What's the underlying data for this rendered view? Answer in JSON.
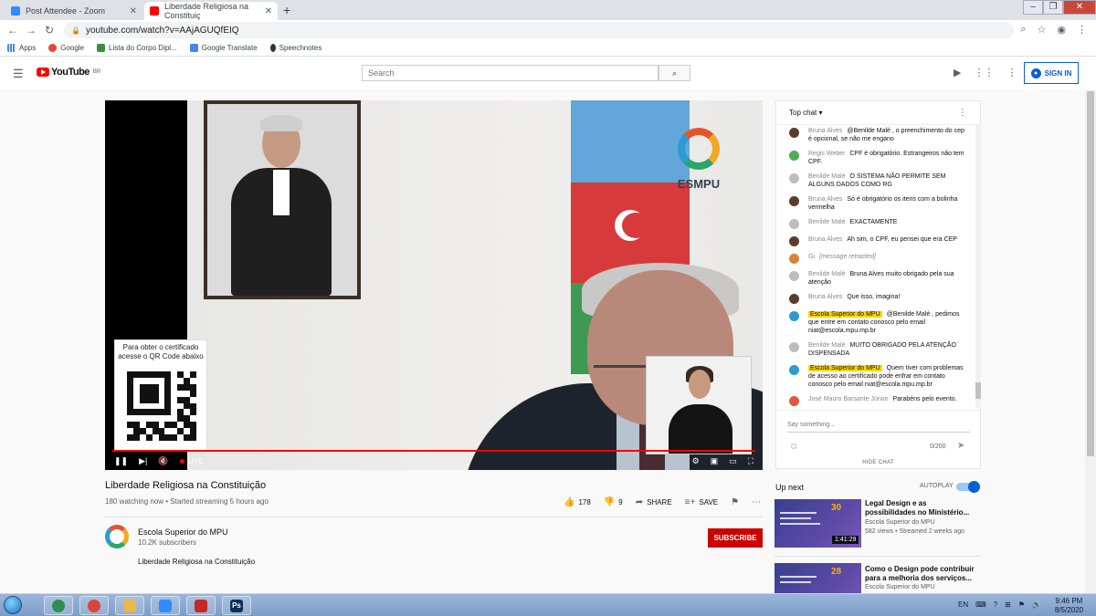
{
  "browser": {
    "tabs": [
      {
        "title": "Post Attendee - Zoom",
        "active": false
      },
      {
        "title": "Liberdade Religiosa na Constituiç",
        "active": true
      }
    ],
    "new_tab": "+",
    "url": "youtube.com/watch?v=AAjAGUQfEIQ",
    "bookmarks": [
      {
        "label": "Apps",
        "icon": "apps-grid-icon"
      },
      {
        "label": "Google",
        "icon": "google-icon"
      },
      {
        "label": "Lista do Corpo Dipl...",
        "icon": "bookmark-flag-icon"
      },
      {
        "label": "Google Translate",
        "icon": "translate-icon"
      },
      {
        "label": "Speechnotes",
        "icon": "microphone-icon"
      }
    ]
  },
  "youtube": {
    "logo_word": "YouTube",
    "region": "BR",
    "search_placeholder": "Search",
    "signin_label": "SIGN IN"
  },
  "player": {
    "qr_caption_line1": "Para obter o certificado",
    "qr_caption_line2": "acesse o QR Code abaixo",
    "brand": "ESMPU",
    "live_label": "LIVE"
  },
  "video": {
    "title": "Liberdade Religiosa na Constituição",
    "meta": "180 watching now • Started streaming 5 hours ago",
    "likes": "178",
    "dislikes": "9",
    "share_label": "SHARE",
    "save_label": "SAVE"
  },
  "channel": {
    "name": "Escola Superior do MPU",
    "subscribers": "10.2K subscribers",
    "subscribe_label": "SUBSCRIBE",
    "description": "Liberdade Religiosa na Constituição"
  },
  "chat": {
    "header": "Top chat",
    "messages": [
      {
        "author": "Bruna Alves",
        "text": "@Benilde Malé , o preenchimento do cep é opcional, se não me engano",
        "avatar_color": "#5a3b2e",
        "owner": false
      },
      {
        "author": "Regis Weber",
        "text": "CPF é obrigatório. Estrangeiros não tem CPF.",
        "avatar_color": "#4caf50",
        "owner": false
      },
      {
        "author": "Benilde Malé",
        "text": "O SISTEMA NÃO PERMITE SEM ALGUNS DADOS COMO RG",
        "avatar_color": "#bdbdbd",
        "owner": false
      },
      {
        "author": "Bruna Alves",
        "text": "Só é obrigatório os itens com a bolinha vermelha",
        "avatar_color": "#5a3b2e",
        "owner": false
      },
      {
        "author": "Benilde Malé",
        "text": "EXACTAMENTE",
        "avatar_color": "#bdbdbd",
        "owner": false
      },
      {
        "author": "Bruna Alves",
        "text": "Ah sim, o CPF, eu pensei que era CEP",
        "avatar_color": "#5a3b2e",
        "owner": false
      },
      {
        "author": "Gi",
        "text": "[message retracted]",
        "avatar_color": "#d9823b",
        "owner": false,
        "retracted": true
      },
      {
        "author": "Benilde Malé",
        "text": "Bruna Alves muito obrigado pela sua atenção",
        "avatar_color": "#bdbdbd",
        "owner": false
      },
      {
        "author": "Bruna Alves",
        "text": "Que isso, imagina!",
        "avatar_color": "#5a3b2e",
        "owner": false
      },
      {
        "author": "Escola Superior do MPU",
        "text": "@Benilde Malé , pedimos que entre em contato conosco pelo email niat@escola.mpu.mp.br",
        "avatar_color": "#2b9bd2",
        "owner": true
      },
      {
        "author": "Benilde Malé",
        "text": "MUITO OBRIGADO PELA ATENÇÃO DISPENSADA",
        "avatar_color": "#bdbdbd",
        "owner": false
      },
      {
        "author": "Escola Superior do MPU",
        "text": "Quem tiver com problemas de acesso ao certificado pode enfrar em contato conosco pelo email niat@escola.mpu.mp.br",
        "avatar_color": "#2b9bd2",
        "owner": true
      },
      {
        "author": "José Mauro Barsante Júnior",
        "text": "Parabéns pelo evento.",
        "avatar_color": "#e05a3a",
        "owner": false
      }
    ],
    "input_placeholder": "Say something...",
    "counter": "0/200",
    "hide_label": "HIDE CHAT"
  },
  "upnext": {
    "label": "Up next",
    "autoplay_label": "AUTOPLAY",
    "autoplay_on": true,
    "items": [
      {
        "title": "Legal Design e as possibilidades no Ministério...",
        "channel": "Escola Superior do MPU",
        "meta": "582 views • Streamed 2 weeks ago",
        "duration": "1:41:29",
        "thumb_number": "30"
      },
      {
        "title": "Como o Design pode contribuir para a melhoria dos serviços...",
        "channel": "Escola Superior do MPU",
        "meta": "",
        "duration": "",
        "thumb_number": "28"
      }
    ]
  },
  "taskbar": {
    "lang": "EN",
    "time": "9:46 PM",
    "date": "8/5/2020",
    "apps": [
      {
        "name": "earth-app-icon",
        "glyph": "",
        "color": "#2f8f4e"
      },
      {
        "name": "chrome-icon",
        "glyph": "",
        "color": "#db4437"
      },
      {
        "name": "folder-icon",
        "glyph": "",
        "color": "#e8b84a"
      },
      {
        "name": "zoom-icon",
        "glyph": "",
        "color": "#2d8cff"
      },
      {
        "name": "pdf-icon",
        "glyph": "",
        "color": "#c62828"
      },
      {
        "name": "photoshop-icon",
        "glyph": "Ps",
        "color": "#0b2f5a"
      }
    ]
  }
}
